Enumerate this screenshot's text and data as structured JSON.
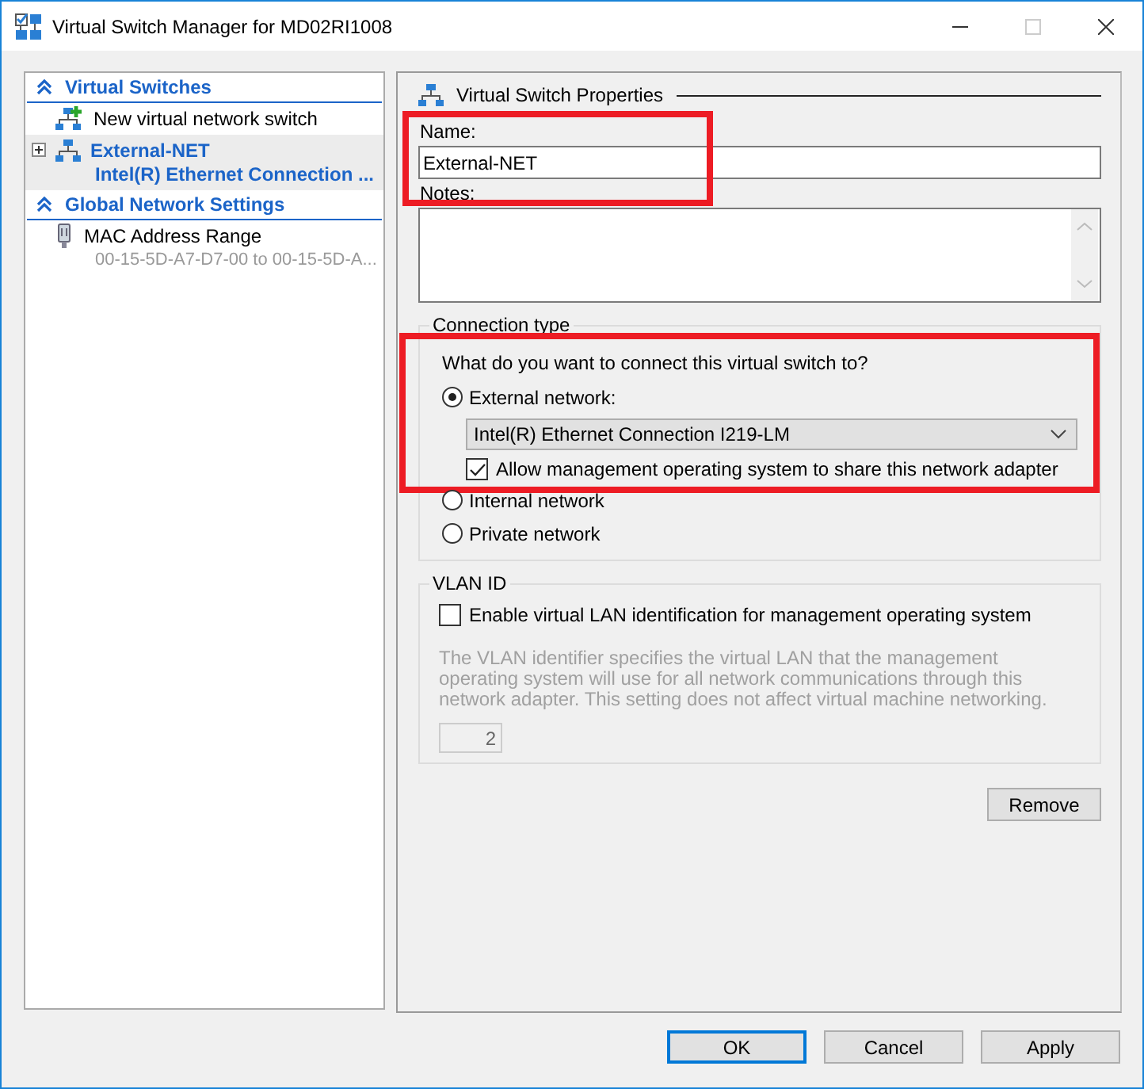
{
  "window": {
    "title": "Virtual Switch Manager for MD02RI1008"
  },
  "sidebar": {
    "sections": [
      {
        "title": "Virtual Switches",
        "expanded": true,
        "items": [
          {
            "kind": "new",
            "label": "New virtual network switch",
            "selected": false
          },
          {
            "kind": "switch",
            "label": "External-NET",
            "sublabel": "Intel(R) Ethernet Connection ...",
            "selected": true,
            "expanded": false
          }
        ]
      },
      {
        "title": "Global Network Settings",
        "expanded": true,
        "items": [
          {
            "kind": "setting",
            "label": "MAC Address Range",
            "sublabel": "00-15-5D-A7-D7-00 to 00-15-5D-A...",
            "selected": false
          }
        ]
      }
    ]
  },
  "properties": {
    "title": "Virtual Switch Properties",
    "name": {
      "label": "Name:",
      "value": "External-NET",
      "highlighted": true
    },
    "notes": {
      "label": "Notes:"
    },
    "connection": {
      "title": "Connection type",
      "question": "What do you want to connect this virtual switch to?",
      "highlighted": true,
      "options": [
        {
          "label": "External network:",
          "selected": true,
          "adapter": "Intel(R) Ethernet Connection I219-LM",
          "share": {
            "label": "Allow management operating system to share this network adapter",
            "checked": true
          }
        },
        {
          "label": "Internal network",
          "selected": false
        },
        {
          "label": "Private network",
          "selected": false
        }
      ]
    },
    "vlan": {
      "title": "VLAN ID",
      "checkbox": {
        "label": "Enable virtual LAN identification for management operating system",
        "checked": false
      },
      "description": "The VLAN identifier specifies the virtual LAN that the management operating system will use for all network communications through this network adapter. This setting does not affect virtual machine networking.",
      "value": "2",
      "disabled": true
    },
    "remove_button": "Remove"
  },
  "buttons": [
    {
      "label": "OK",
      "default": true
    },
    {
      "label": "Cancel",
      "default": false
    },
    {
      "label": "Apply",
      "default": false
    }
  ]
}
